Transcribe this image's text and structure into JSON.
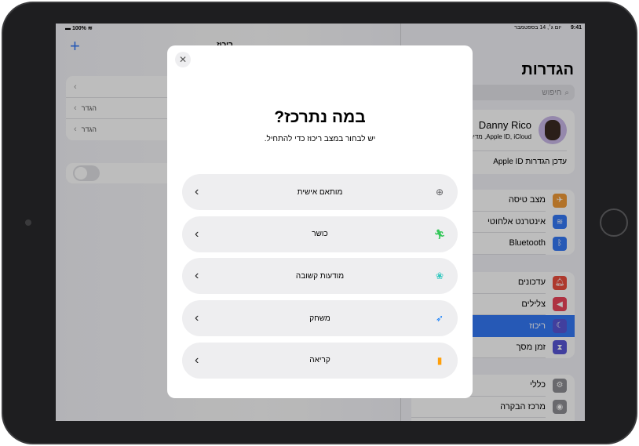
{
  "status": {
    "time": "9:41",
    "date": "יום ג׳, 14 בספטמבר",
    "battery": "100%"
  },
  "detail": {
    "header_title": "ריכוז",
    "rows": [
      {
        "label": ""
      },
      {
        "label": "הגדר"
      },
      {
        "label": "הגדר"
      }
    ]
  },
  "sidebar": {
    "title": "הגדרות",
    "search_placeholder": "חיפוש",
    "profile": {
      "name": "Danny Rico",
      "subtitle": "Apple ID, iCloud, מדיה ורכישות",
      "update": "עדכן הגדרות Apple ID"
    },
    "groups": [
      [
        {
          "label": "מצב טיסה",
          "icon": "airplane-icon",
          "color": "#f09a37"
        },
        {
          "label": "אינטרנט אלחוטי",
          "icon": "wifi-icon",
          "color": "#3478f6"
        },
        {
          "label": "Bluetooth",
          "icon": "bluetooth-icon",
          "color": "#3478f6"
        }
      ],
      [
        {
          "label": "עדכונים",
          "icon": "bell-icon",
          "color": "#eb4e3d"
        },
        {
          "label": "צלילים",
          "icon": "speaker-icon",
          "color": "#eb445a"
        },
        {
          "label": "ריכוז",
          "icon": "moon-icon",
          "color": "#5856d6",
          "selected": true
        },
        {
          "label": "זמן מסך",
          "icon": "hourglass-icon",
          "color": "#5856d6"
        }
      ],
      [
        {
          "label": "כללי",
          "icon": "gear-icon",
          "color": "#8e8e93"
        },
        {
          "label": "מרכז הבקרה",
          "icon": "switches-icon",
          "color": "#8e8e93"
        }
      ]
    ]
  },
  "modal": {
    "title": "במה נתרכז?",
    "subtitle": "יש לבחור במצב ריכוז כדי להתחיל.",
    "options": [
      {
        "label": "מותאם אישית",
        "icon": "plus-circle-icon",
        "color": "#636366"
      },
      {
        "label": "כושר",
        "icon": "running-icon",
        "color": "#34c759"
      },
      {
        "label": "מודעות קשובה",
        "icon": "flower-icon",
        "color": "#30c7be"
      },
      {
        "label": "משחק",
        "icon": "rocket-icon",
        "color": "#147efb"
      },
      {
        "label": "קריאה",
        "icon": "book-icon",
        "color": "#ff9f0a"
      }
    ]
  },
  "colors": {
    "accent": "#3478f6",
    "selected_row": "#3478f6"
  }
}
